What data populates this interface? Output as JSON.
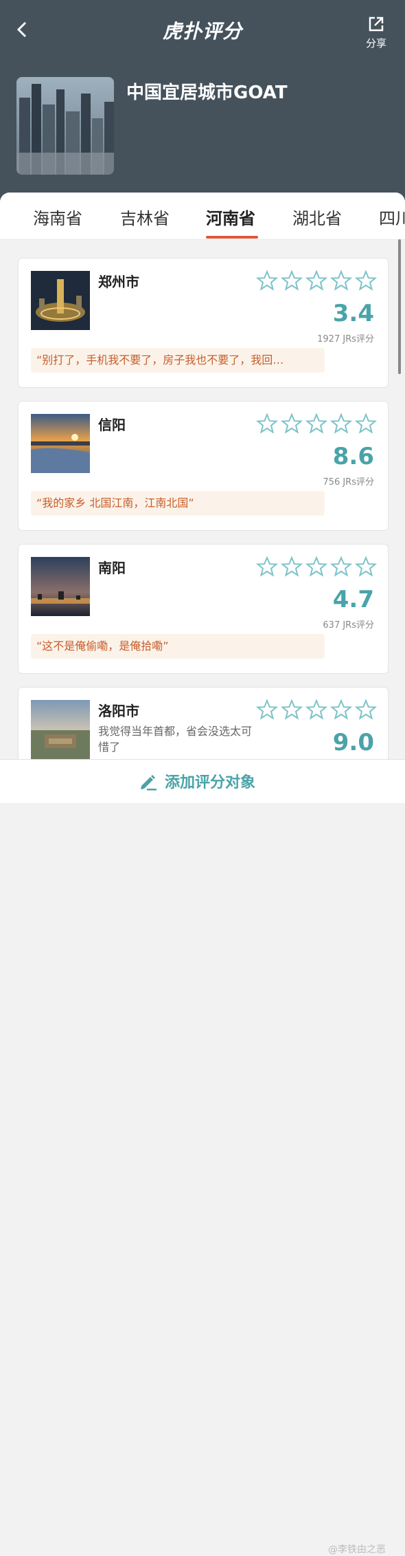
{
  "header": {
    "back_icon": "chevron-left-icon",
    "logo": "虎扑评分",
    "share_label": "分享",
    "share_icon": "share-external-icon",
    "title": "中国宜居城市GOAT"
  },
  "tabs": [
    "海南省",
    "吉林省",
    "河南省",
    "湖北省",
    "四川"
  ],
  "active_tab": "河南省",
  "colors": {
    "header": "#45525c",
    "accent": "#4aa3a8",
    "tab_underline": "#d9593b",
    "quote_text": "#c75d2a"
  },
  "cards": [
    {
      "name": "郑州市",
      "score": "3.4",
      "count": "1927 JRs评分",
      "quote": "“别打了，手机我不要了，房子我也不要了，我回…"
    },
    {
      "name": "信阳",
      "score": "8.6",
      "count": "756 JRs评分",
      "quote": "“我的家乡 北国江南，江南北国”"
    },
    {
      "name": "南阳",
      "score": "4.7",
      "count": "637 JRs评分",
      "quote": "“这不是俺偷嘞，是俺拾嘞”"
    },
    {
      "name": "洛阳市",
      "score": "9.0",
      "desc": "我觉得当年首都，省会没选太可惜了"
    }
  ],
  "bottom": {
    "add_label": "添加评分对象",
    "add_icon": "pen-icon"
  },
  "watermark": "@李铁由之恶"
}
